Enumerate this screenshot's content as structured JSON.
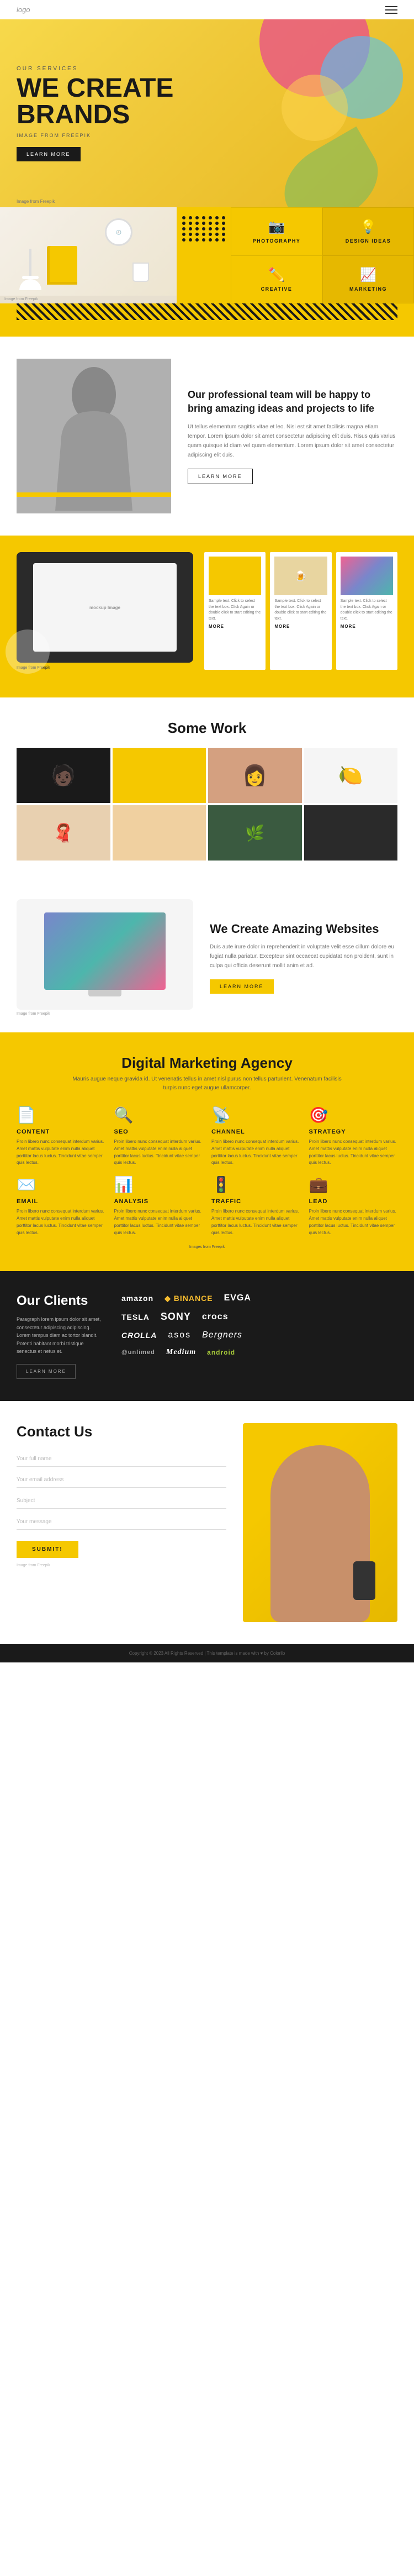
{
  "nav": {
    "logo": "logo",
    "menu_icon_label": "menu"
  },
  "hero": {
    "subtitle": "OUR SERVICES",
    "title": "WE CREATE\nBRANDS",
    "description": "IMAGE FROM FREEPIK",
    "cta_label": "LEARN MORE",
    "image_credit": "Image from Freepik"
  },
  "services": {
    "items": [
      {
        "icon": "📷",
        "label": "PHOTOGRAPHY"
      },
      {
        "icon": "💡",
        "label": "DESIGN IDEAS"
      },
      {
        "icon": "✏️",
        "label": "CREATIVE"
      },
      {
        "icon": "📈",
        "label": "MARKETING"
      }
    ],
    "image_credit": "Image from Freepik"
  },
  "about": {
    "title": "Our professional team will be happy to bring amazing ideas and projects to life",
    "text": "Ut tellus elementum sagittis vitae et leo. Nisi est sit amet facilisis magna etiam tempor. Lorem ipsum dolor sit amet consectetur adipiscing elit duis. Risus quis varius quam quisque id diam vel quam elementum. Lorem ipsum dolor sit amet consectetur adipiscing elit duis.",
    "cta_label": "LEARN MORE"
  },
  "portfolio": {
    "title": "mockup\nImage",
    "image_credit": "Image from Freepik",
    "samples": [
      {
        "text": "Sample text. Click to select the text box. Click Again or double click to start editing the text.",
        "more": "MORE"
      },
      {
        "text": "Sample text. Click to select the text box. Click Again or double click to start editing the text.",
        "more": "MORE"
      },
      {
        "text": "Sample text. Click to select the text box. Click Again or double click to start editing the text.",
        "more": "MORE"
      }
    ]
  },
  "work": {
    "section_title": "Some Work"
  },
  "amazing": {
    "title": "We Create\nAmazing Websites",
    "text": "Duis aute irure dolor in reprehenderit in voluptate velit esse cillum dolore eu fugiat nulla pariatur. Excepteur sint occaecat cupidatat non proident, sunt in culpa qui officia deserunt mollit anim et ad.",
    "cta_label": "LEARN MORE",
    "image_credit": "Image from Freepik"
  },
  "marketing": {
    "title": "Digital Marketing Agency",
    "subtitle": "Mauris augue neque gravida id. Ut venenatis tellus in amet nisl purus non tellus parturient. Venenatum facilisis turpis nunc eget augue ullamcorper.",
    "items": [
      {
        "icon": "📄",
        "label": "CONTENT",
        "text": "Proin libero nunc consequat interdum varius. Amet mattis vulputate enim nulla aliquet porttitor lacus luctus. Tincidunt vitae semper quis lectus."
      },
      {
        "icon": "🔍",
        "label": "SEO",
        "text": "Proin libero nunc consequat interdum varius. Amet mattis vulputate enim nulla aliquet porttitor lacus luctus. Tincidunt vitae semper quis lectus."
      },
      {
        "icon": "📡",
        "label": "CHANNEL",
        "text": "Proin libero nunc consequat interdum varius. Amet mattis vulputate enim nulla aliquet porttitor lacus luctus. Tincidunt vitae semper quis lectus."
      },
      {
        "icon": "🎯",
        "label": "STRATEGY",
        "text": "Proin libero nunc consequat interdum varius. Amet mattis vulputate enim nulla aliquet porttitor lacus luctus. Tincidunt vitae semper quis lectus."
      },
      {
        "icon": "✉️",
        "label": "EMAIL",
        "text": "Proin libero nunc consequat interdum varius. Amet mattis vulputate enim nulla aliquet porttitor lacus luctus. Tincidunt vitae semper quis lectus."
      },
      {
        "icon": "📊",
        "label": "ANALYSIS",
        "text": "Proin libero nunc consequat interdum varius. Amet mattis vulputate enim nulla aliquet porttitor lacus luctus. Tincidunt vitae semper quis lectus."
      },
      {
        "icon": "🚦",
        "label": "TRAFFIC",
        "text": "Proin libero nunc consequat interdum varius. Amet mattis vulputate enim nulla aliquet porttitor lacus luctus. Tincidunt vitae semper quis lectus."
      },
      {
        "icon": "💼",
        "label": "LEAD",
        "text": "Proin libero nunc consequat interdum varius. Amet mattis vulputate enim nulla aliquet porttitor lacus luctus. Tincidunt vitae semper quis lectus."
      }
    ],
    "image_credit": "Images from Freepik"
  },
  "clients": {
    "title": "Our Clients",
    "text": "Paragraph lorem ipsum dolor sit amet, consectetur adipiscing adipiscing. Lorem tempus diam ac tortor blandit. Potenti habitant morbi tristique senectus et netus et.",
    "cta_label": "LEARN MORE",
    "logos": [
      [
        "amazon",
        "BINANCE",
        "EVGA"
      ],
      [
        "TESLA",
        "SONY",
        "crocs"
      ],
      [
        "CROLLA",
        "asos",
        "Bergners"
      ],
      [
        "@unlimed",
        "Medium",
        "android"
      ]
    ]
  },
  "contact": {
    "title": "Contact Us",
    "fields": [
      {
        "placeholder": "Your full name"
      },
      {
        "placeholder": "Your email address"
      },
      {
        "placeholder": "Subject"
      },
      {
        "placeholder": "Your message"
      }
    ],
    "submit_label": "SUBMIT!",
    "image_credit": "Image from Freepik"
  },
  "footer": {
    "copyright": "Copyright © 2023 All Rights Reserved | This template is made with ♥ by Colorlib"
  }
}
